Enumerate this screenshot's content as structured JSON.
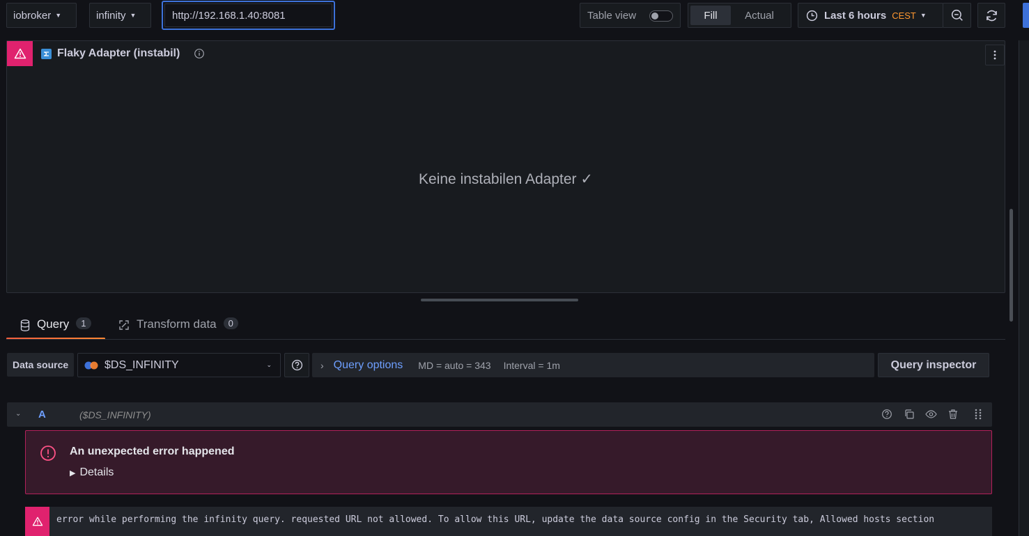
{
  "toolbar": {
    "var1_label": "iobroker",
    "var2_label": "infinity",
    "url_value": "http://192.168.1.40:8081",
    "table_view_label": "Table view",
    "fill_label": "Fill",
    "actual_label": "Actual",
    "time_range_label": "Last 6 hours",
    "timezone_label": "CEST"
  },
  "panel": {
    "title": "Flaky Adapter (instabil)",
    "message": "Keine instabilen Adapter ✓"
  },
  "tabs": [
    {
      "label": "Query",
      "count": "1"
    },
    {
      "label": "Transform data",
      "count": "0"
    }
  ],
  "query_row": {
    "data_source_label": "Data source",
    "data_source_value": "$DS_INFINITY",
    "query_options_label": "Query options",
    "md_text": "MD = auto = 343",
    "interval_text": "Interval = 1m",
    "query_inspector_label": "Query inspector"
  },
  "query_header": {
    "ref_id": "A",
    "datasource": "($DS_INFINITY)"
  },
  "error": {
    "title": "An unexpected error happened",
    "details_label": "Details",
    "message": "error while performing the infinity query. requested URL not allowed. To allow this URL, update the data source config in the Security tab, Allowed hosts section"
  },
  "colors": {
    "accent_blue": "#3d71d9",
    "error_pink": "#e0226e",
    "tab_orange": "#ff8833",
    "timezone_orange": "#ff9830"
  }
}
